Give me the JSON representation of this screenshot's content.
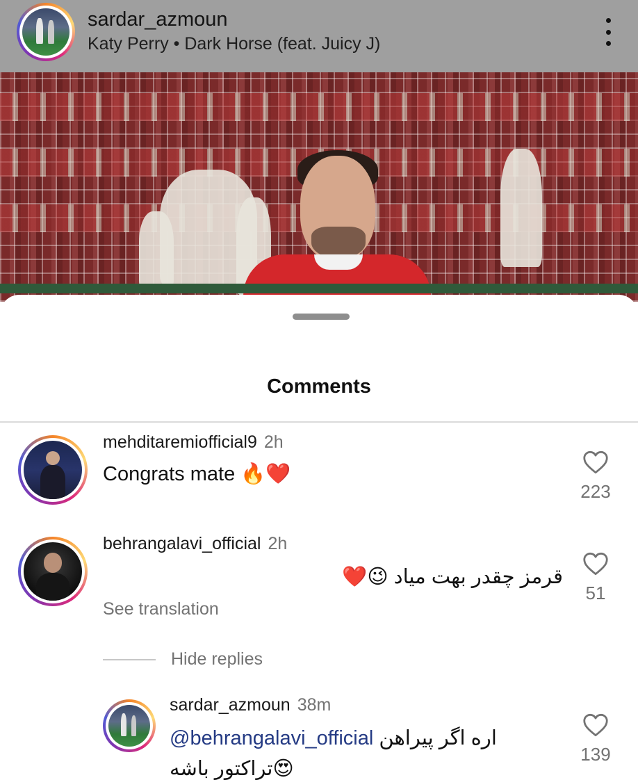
{
  "post": {
    "username": "sardar_azmoun",
    "music": "Katy Perry • Dark Horse (feat. Juicy J)",
    "more_icon": "more-vertical-icon"
  },
  "sheet": {
    "title": "Comments"
  },
  "comments": [
    {
      "username": "mehditaremiofficial9",
      "time": "2h",
      "text": "Congrats mate",
      "emojis": "🔥❤️",
      "likes": "223"
    },
    {
      "username": "behrangalavi_official",
      "time": "2h",
      "text": "قرمز چقدر بهت میاد",
      "emojis": "😉❤️",
      "likes": "51",
      "see_translation": "See translation",
      "hide_replies": "Hide replies"
    }
  ],
  "reply": {
    "username": "sardar_azmoun",
    "time": "38m",
    "mention": "@behrangalavi_official",
    "text_line1": "اره اگر پیراهن",
    "text_line2": "تراکتور باشه",
    "emoji": "😍",
    "likes": "139"
  },
  "colors": {
    "like_count": "#737373",
    "mention": "#253b84",
    "avatar_ring": [
      "#f58529",
      "#dd2a7b",
      "#8134af"
    ]
  }
}
